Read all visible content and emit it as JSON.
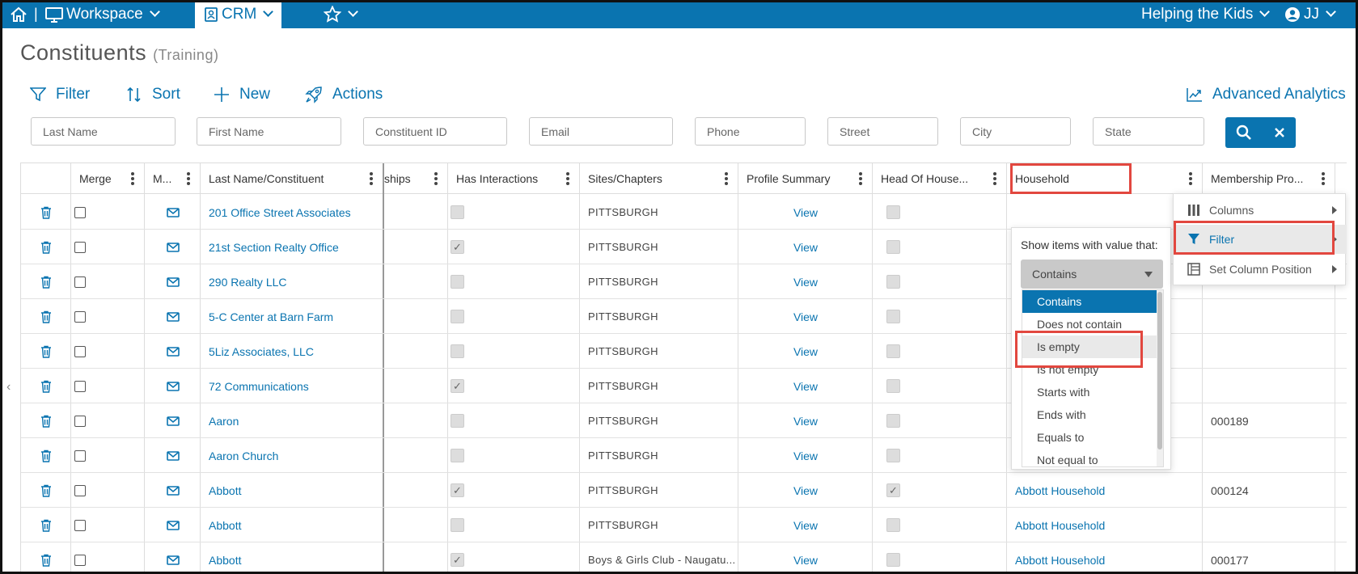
{
  "topbar": {
    "workspace": "Workspace",
    "crm": "CRM",
    "org": "Helping the Kids",
    "user": "JJ"
  },
  "page": {
    "title": "Constituents",
    "subtitle": "(Training)"
  },
  "toolbar": {
    "filter": "Filter",
    "sort": "Sort",
    "new": "New",
    "actions": "Actions",
    "analytics": "Advanced Analytics"
  },
  "search": {
    "last_name": "Last Name",
    "first_name": "First Name",
    "constituent_id": "Constituent ID",
    "email": "Email",
    "phone": "Phone",
    "street": "Street",
    "city": "City",
    "state": "State"
  },
  "columns": {
    "merge": "Merge",
    "mail": "M...",
    "name": "Last Name/Constituent",
    "relationships": "ships",
    "interactions": "Has Interactions",
    "sites": "Sites/Chapters",
    "profile": "Profile Summary",
    "head": "Head Of House...",
    "household": "Household",
    "membership": "Membership Pro..."
  },
  "rows": [
    {
      "name": "201 Office Street Associates",
      "interactions": false,
      "site": "PITTSBURGH",
      "profile": "View",
      "head": false,
      "household": "",
      "membership": ""
    },
    {
      "name": "21st Section Realty Office",
      "interactions": true,
      "site": "PITTSBURGH",
      "profile": "View",
      "head": false,
      "household": "",
      "membership": ""
    },
    {
      "name": "290 Realty LLC",
      "interactions": false,
      "site": "PITTSBURGH",
      "profile": "View",
      "head": false,
      "household": "",
      "membership": ""
    },
    {
      "name": "5-C Center at Barn Farm",
      "interactions": false,
      "site": "PITTSBURGH",
      "profile": "View",
      "head": false,
      "household": "",
      "membership": ""
    },
    {
      "name": "5Liz Associates, LLC",
      "interactions": false,
      "site": "PITTSBURGH",
      "profile": "View",
      "head": false,
      "household": "",
      "membership": ""
    },
    {
      "name": "72 Communications",
      "interactions": true,
      "site": "PITTSBURGH",
      "profile": "View",
      "head": false,
      "household": "",
      "membership": ""
    },
    {
      "name": "Aaron",
      "interactions": false,
      "site": "PITTSBURGH",
      "profile": "View",
      "head": false,
      "household": "",
      "membership": "000189"
    },
    {
      "name": "Aaron Church",
      "interactions": false,
      "site": "PITTSBURGH",
      "profile": "View",
      "head": false,
      "household": "",
      "membership": ""
    },
    {
      "name": "Abbott",
      "interactions": true,
      "site": "PITTSBURGH",
      "profile": "View",
      "head": true,
      "household": "Abbott Household",
      "membership": "000124"
    },
    {
      "name": "Abbott",
      "interactions": false,
      "site": "PITTSBURGH",
      "profile": "View",
      "head": false,
      "household": "Abbott Household",
      "membership": ""
    },
    {
      "name": "Abbott",
      "interactions": true,
      "site": "Boys & Girls Club - Naugatu...",
      "profile": "View",
      "head": false,
      "household": "Abbott Household",
      "membership": "000177"
    }
  ],
  "filter_popup": {
    "label": "Show items with value that:",
    "selected": "Contains",
    "options": [
      "Contains",
      "Does not contain",
      "Is empty",
      "Is not empty",
      "Starts with",
      "Ends with",
      "Equals to",
      "Not equal to"
    ]
  },
  "column_menu": {
    "columns": "Columns",
    "filter": "Filter",
    "set_position": "Set Column Position"
  },
  "colors": {
    "brand": "#0a74b0",
    "highlight": "#e2473f"
  }
}
